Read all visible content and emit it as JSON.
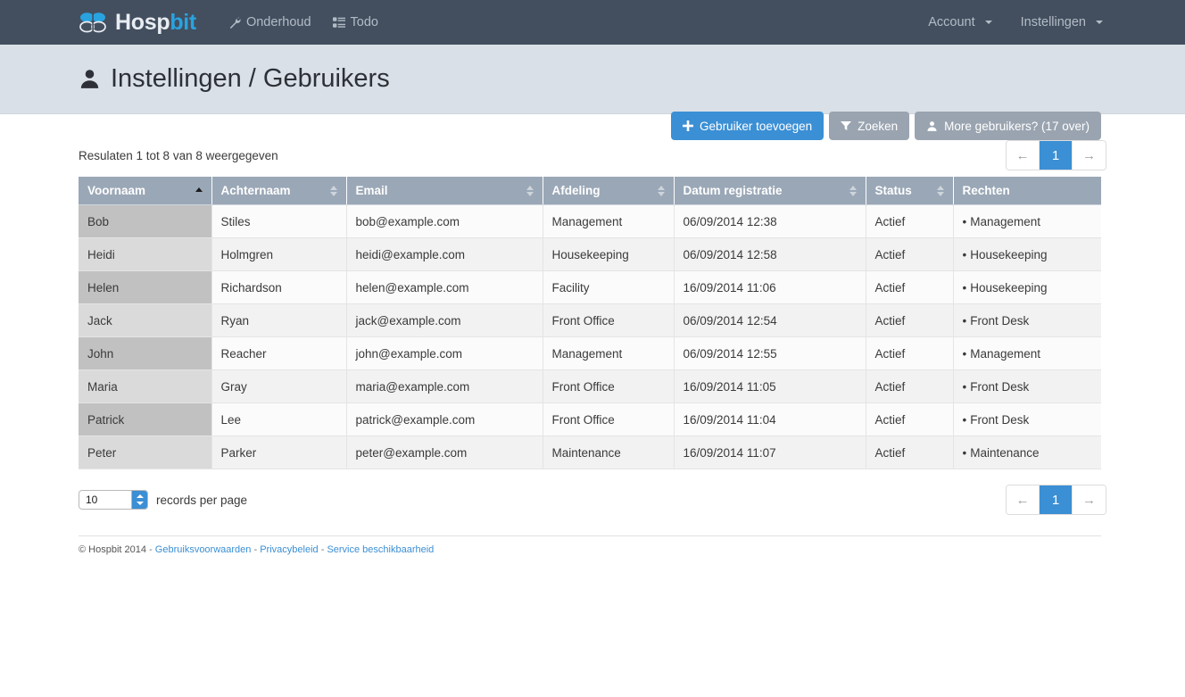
{
  "navbar": {
    "brand": {
      "text_dark": "Hosp",
      "text_accent": "bit",
      "logo_icon": "hospbit-logo-icon"
    },
    "links": [
      {
        "label": "Onderhoud",
        "icon": "wrench-icon"
      },
      {
        "label": "Todo",
        "icon": "tasks-list-icon"
      }
    ],
    "right_menus": [
      {
        "label": "Account",
        "icon": "chevron-down-icon"
      },
      {
        "label": "Instellingen",
        "icon": "chevron-down-icon"
      }
    ],
    "background_color": "#434f5f",
    "accent_color": "#29a3e0"
  },
  "page_header": {
    "title": "Instellingen / Gebruikers",
    "title_icon": "user-icon",
    "background_color": "#d9e0e7",
    "buttons": [
      {
        "label": "Gebruiker toevoegen",
        "icon": "plus-icon",
        "style": "primary"
      },
      {
        "label": "Zoeken",
        "icon": "filter-icon",
        "style": "muted"
      },
      {
        "label": "More gebruikers? (17 over)",
        "icon": "user-icon",
        "style": "muted"
      }
    ]
  },
  "table_toolbar": {
    "result_info": "Resulaten 1 tot 8 van 8 weergegeven",
    "pagination": {
      "prev_label": "←",
      "next_label": "→",
      "pages": [
        "1"
      ],
      "active_page": "1",
      "active_color": "#3b8fd4"
    }
  },
  "table": {
    "columns": [
      {
        "label": "Voornaam",
        "sort": "asc"
      },
      {
        "label": "Achternaam",
        "sort": "none"
      },
      {
        "label": "Email",
        "sort": "none"
      },
      {
        "label": "Afdeling",
        "sort": "none"
      },
      {
        "label": "Datum registratie",
        "sort": "none"
      },
      {
        "label": "Status",
        "sort": "none"
      },
      {
        "label": "Rechten",
        "sort": ""
      }
    ],
    "rows": [
      {
        "voornaam": "Bob",
        "achternaam": "Stiles",
        "email": "bob@example.com",
        "afdeling": "Management",
        "datum": "06/09/2014 12:38",
        "status": "Actief",
        "rechten": "Management"
      },
      {
        "voornaam": "Heidi",
        "achternaam": "Holmgren",
        "email": "heidi@example.com",
        "afdeling": "Housekeeping",
        "datum": "06/09/2014 12:58",
        "status": "Actief",
        "rechten": "Housekeeping"
      },
      {
        "voornaam": "Helen",
        "achternaam": "Richardson",
        "email": "helen@example.com",
        "afdeling": "Facility",
        "datum": "16/09/2014 11:06",
        "status": "Actief",
        "rechten": "Housekeeping"
      },
      {
        "voornaam": "Jack",
        "achternaam": "Ryan",
        "email": "jack@example.com",
        "afdeling": "Front Office",
        "datum": "06/09/2014 12:54",
        "status": "Actief",
        "rechten": "Front Desk"
      },
      {
        "voornaam": "John",
        "achternaam": "Reacher",
        "email": "john@example.com",
        "afdeling": "Management",
        "datum": "06/09/2014 12:55",
        "status": "Actief",
        "rechten": "Management"
      },
      {
        "voornaam": "Maria",
        "achternaam": "Gray",
        "email": "maria@example.com",
        "afdeling": "Front Office",
        "datum": "16/09/2014 11:05",
        "status": "Actief",
        "rechten": "Front Desk"
      },
      {
        "voornaam": "Patrick",
        "achternaam": "Lee",
        "email": "patrick@example.com",
        "afdeling": "Front Office",
        "datum": "16/09/2014 11:04",
        "status": "Actief",
        "rechten": "Front Desk"
      },
      {
        "voornaam": "Peter",
        "achternaam": "Parker",
        "email": "peter@example.com",
        "afdeling": "Maintenance",
        "datum": "16/09/2014 11:07",
        "status": "Actief",
        "rechten": "Maintenance"
      }
    ],
    "status_color": "#2e8b38",
    "bullet": "•"
  },
  "table_footer": {
    "records_select_value": "10",
    "records_label": "records per page",
    "pagination": {
      "prev_label": "←",
      "next_label": "→",
      "pages": [
        "1"
      ],
      "active_page": "1"
    }
  },
  "footer": {
    "copyright": "© Hospbit 2014",
    "sep": "-",
    "links": [
      {
        "label": "Gebruiksvoorwaarden"
      },
      {
        "label": "Privacybeleid"
      },
      {
        "label": "Service beschikbaarheid"
      }
    ]
  }
}
